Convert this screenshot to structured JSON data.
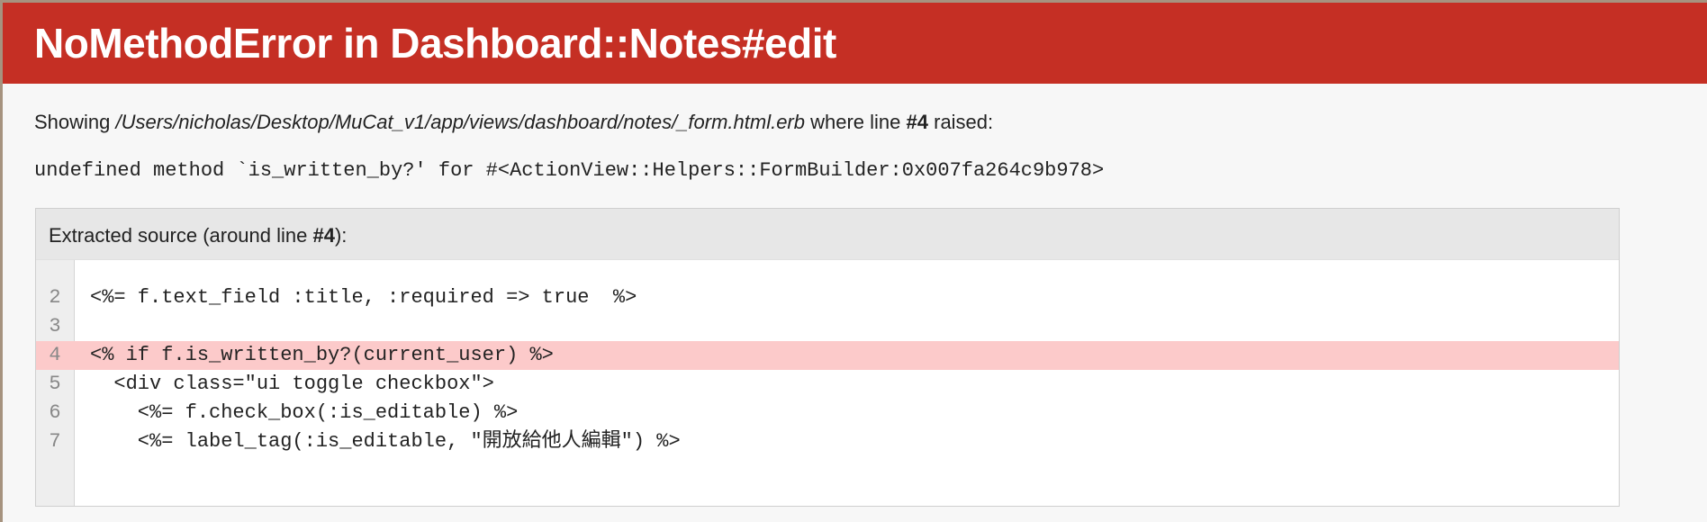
{
  "header": {
    "title": "NoMethodError in Dashboard::Notes#edit"
  },
  "showing": {
    "prefix": "Showing ",
    "path": "/Users/nicholas/Desktop/MuCat_v1/app/views/dashboard/notes/_form.html.erb",
    "middle": " where line ",
    "line_ref": "#4",
    "suffix": " raised:"
  },
  "error_message": "undefined method `is_written_by?' for #<ActionView::Helpers::FormBuilder:0x007fa264c9b978>",
  "source": {
    "title_prefix": "Extracted source (around line ",
    "title_line": "#4",
    "title_suffix": "):",
    "highlighted_line": "4",
    "lines": [
      {
        "num": "2",
        "text": "<%= f.text_field :title, :required => true  %>"
      },
      {
        "num": "3",
        "text": ""
      },
      {
        "num": "4",
        "text": "<% if f.is_written_by?(current_user) %>"
      },
      {
        "num": "5",
        "text": "  <div class=\"ui toggle checkbox\">"
      },
      {
        "num": "6",
        "text": "    <%= f.check_box(:is_editable) %>"
      },
      {
        "num": "7",
        "text": "    <%= label_tag(:is_editable, \"開放給他人編輯\") %>"
      }
    ]
  },
  "colors": {
    "header_bg": "#c52f24",
    "highlight_bg": "#fccaca",
    "page_bg": "#f7f7f7"
  }
}
